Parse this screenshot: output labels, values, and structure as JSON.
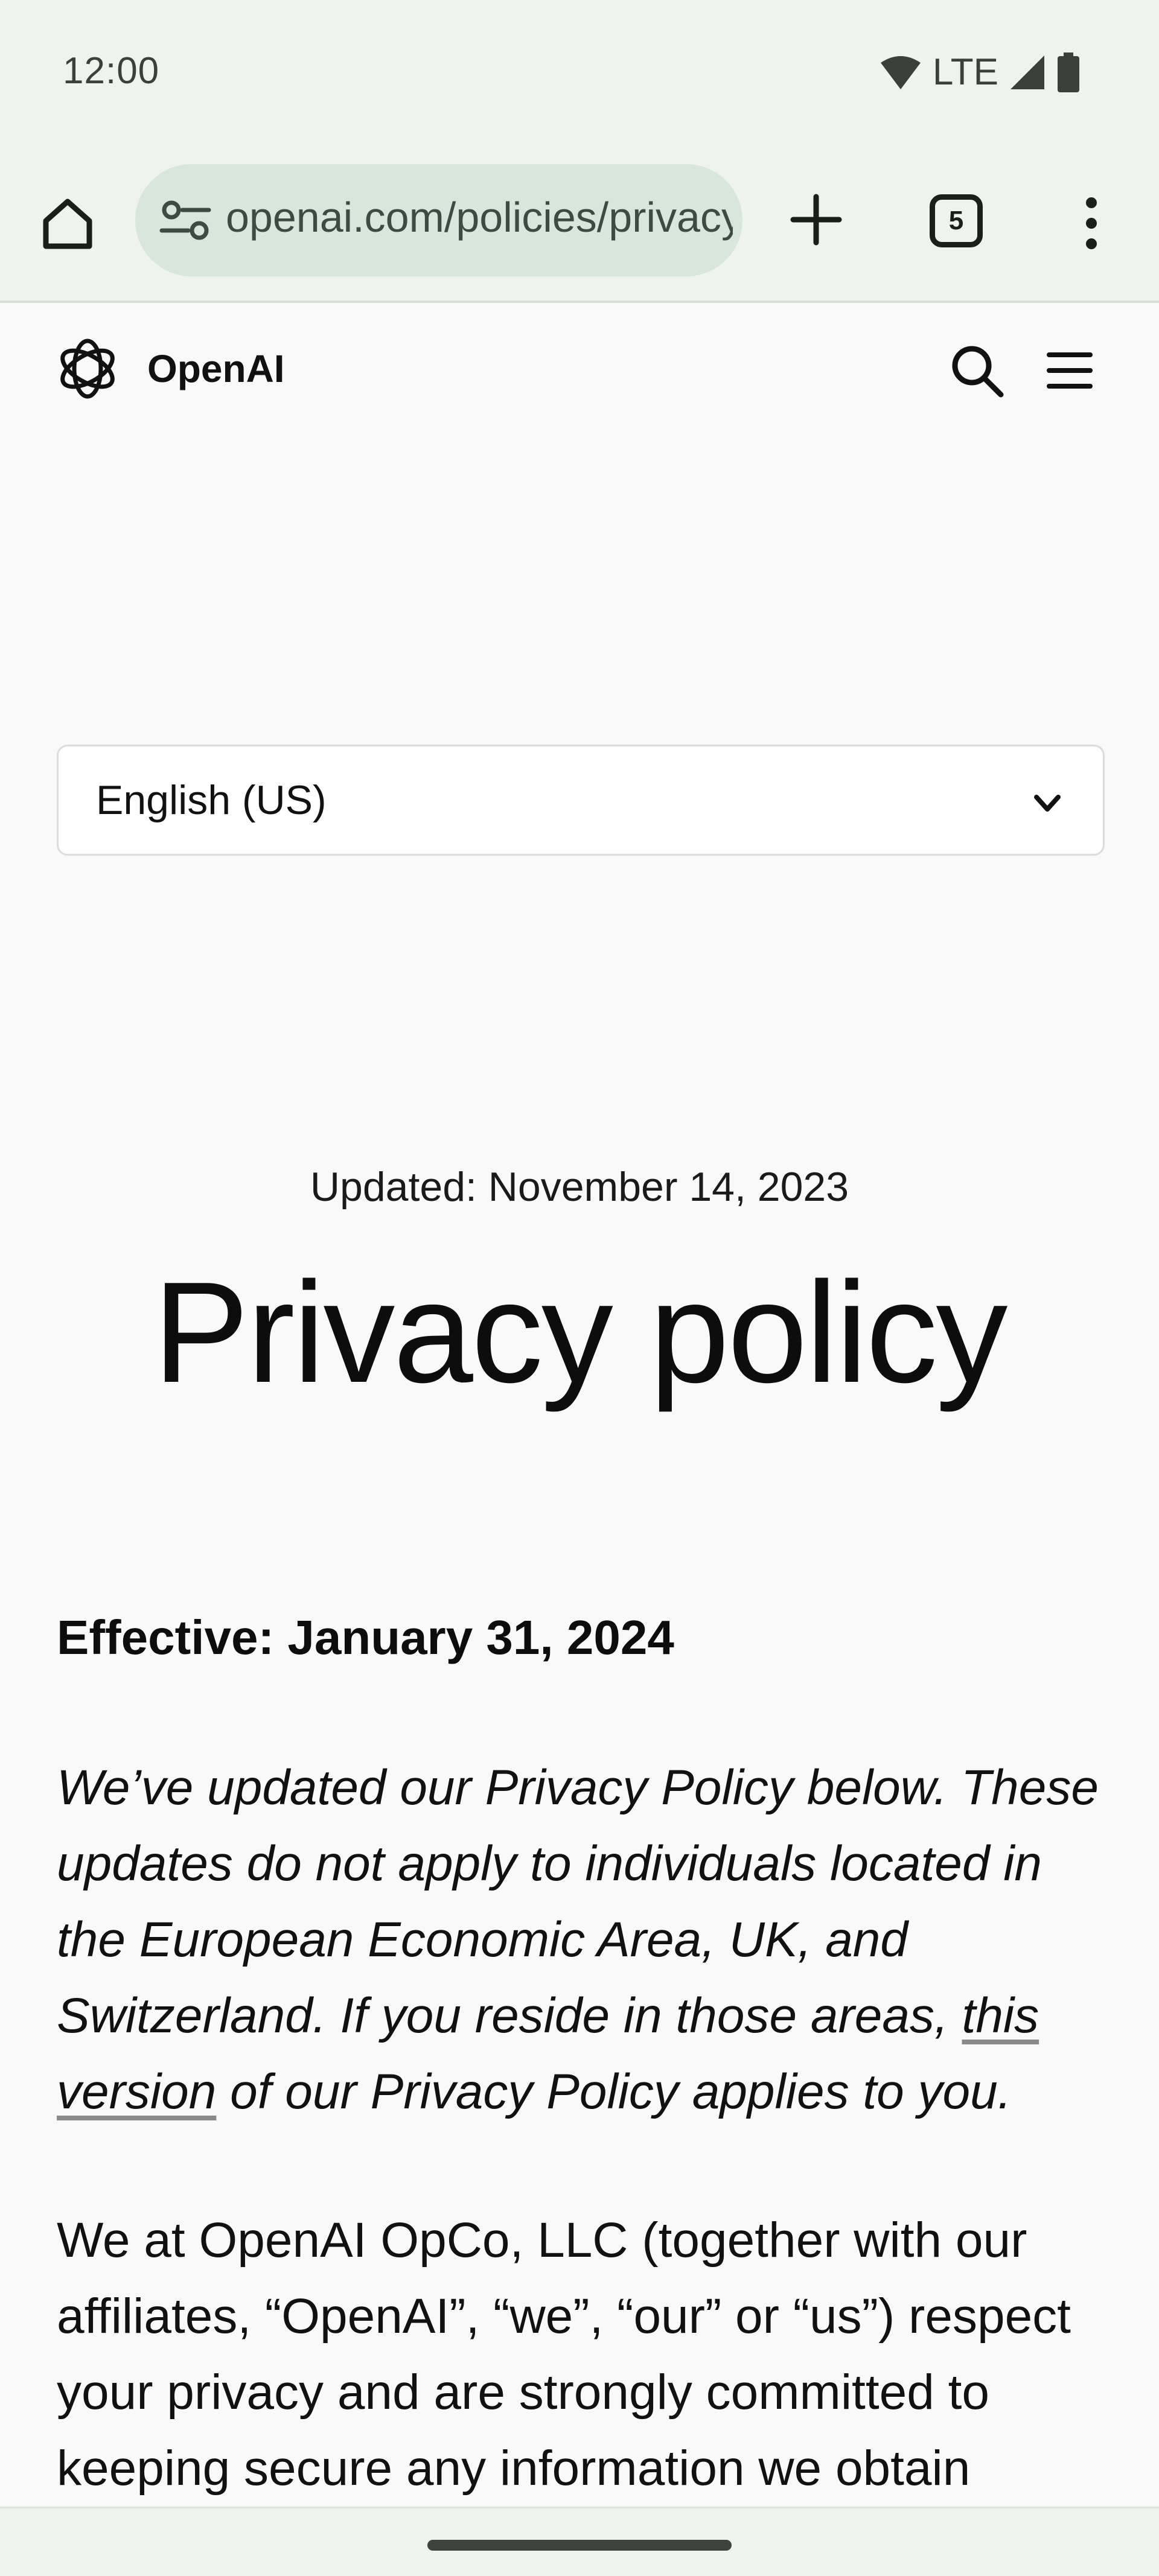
{
  "status_bar": {
    "time": "12:00",
    "network": "LTE",
    "icons": [
      "wifi-icon",
      "signal-icon",
      "battery-icon"
    ]
  },
  "browser": {
    "url": "openai.com/policies/privacy-policy",
    "tab_count": "5",
    "icons": [
      "home-icon",
      "site-settings-icon",
      "new-tab-icon",
      "more-vert-icon"
    ]
  },
  "site": {
    "brand": "OpenAI",
    "icons": [
      "openai-logo-icon",
      "search-icon",
      "hamburger-menu-icon"
    ]
  },
  "language_select": {
    "value": "English (US)"
  },
  "article": {
    "updated": "Updated: November 14, 2023",
    "title": "Privacy policy",
    "effective": "Effective: January 31, 2024",
    "notice_before": "We’ve updated our Privacy Policy below. These updates do not apply to individuals located in the European Economic Area, UK, and Switzerland. If you reside in those areas, ",
    "notice_link": "this version",
    "notice_after": " of our Privacy Policy applies to you.",
    "intro": "We at OpenAI OpCo, LLC (together with our affiliates, “OpenAI”, “we”, “our” or “us”) respect your privacy and are strongly committed to keeping secure any information we obtain"
  },
  "colors": {
    "page_background": "#f9f9f9",
    "chrome_background": "#eef3ee",
    "url_bar": "#d9e6dc",
    "text": "#0d0d0d"
  }
}
